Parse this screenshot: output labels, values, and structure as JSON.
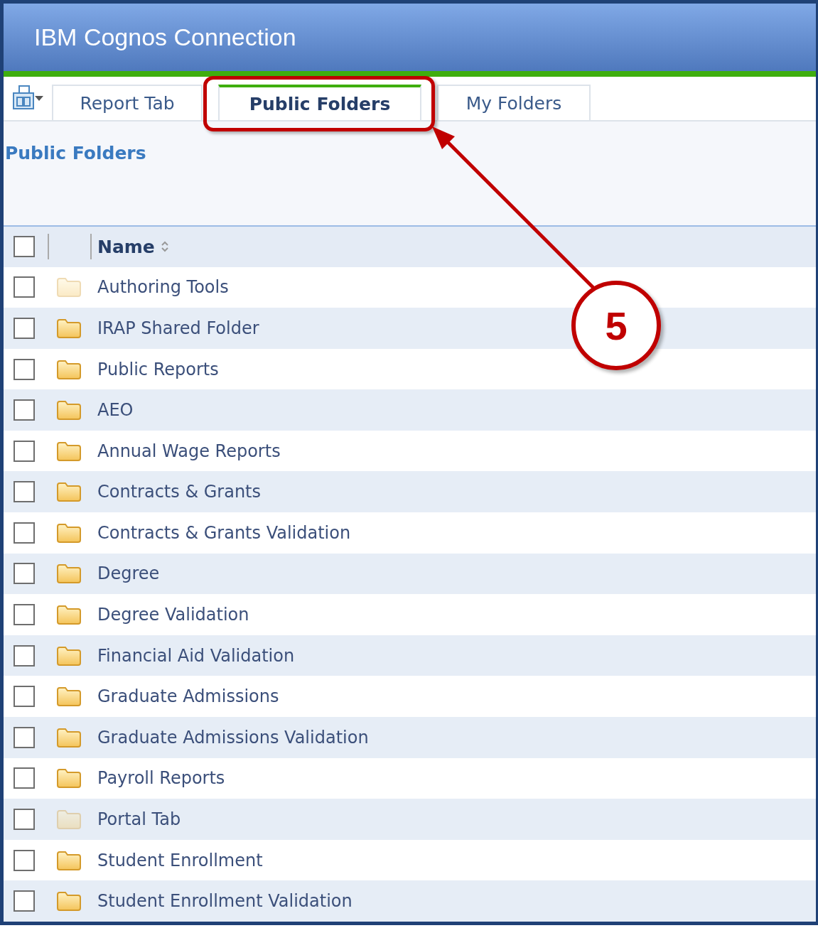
{
  "window": {
    "title": "IBM Cognos Connection"
  },
  "tabs": [
    {
      "label": "Report Tab",
      "selected": false
    },
    {
      "label": "Public Folders",
      "selected": true
    },
    {
      "label": "My Folders",
      "selected": false
    }
  ],
  "page_title": "Public Folders",
  "table": {
    "columns": [
      "Name"
    ],
    "header_checked": false,
    "rows": [
      {
        "name": "Authoring Tools",
        "checked": false,
        "hidden": true
      },
      {
        "name": "IRAP Shared Folder",
        "checked": false,
        "hidden": false
      },
      {
        "name": "Public Reports",
        "checked": false,
        "hidden": false
      },
      {
        "name": "AEO",
        "checked": false,
        "hidden": false
      },
      {
        "name": "Annual Wage Reports",
        "checked": false,
        "hidden": false
      },
      {
        "name": "Contracts & Grants",
        "checked": false,
        "hidden": false
      },
      {
        "name": "Contracts & Grants Validation",
        "checked": false,
        "hidden": false
      },
      {
        "name": "Degree",
        "checked": false,
        "hidden": false
      },
      {
        "name": "Degree Validation",
        "checked": false,
        "hidden": false
      },
      {
        "name": "Financial Aid Validation",
        "checked": false,
        "hidden": false
      },
      {
        "name": "Graduate Admissions",
        "checked": false,
        "hidden": false
      },
      {
        "name": "Graduate Admissions Validation",
        "checked": false,
        "hidden": false
      },
      {
        "name": "Payroll Reports",
        "checked": false,
        "hidden": false
      },
      {
        "name": "Portal Tab",
        "checked": false,
        "hidden": true
      },
      {
        "name": "Student Enrollment",
        "checked": false,
        "hidden": false
      },
      {
        "name": "Student Enrollment Validation",
        "checked": false,
        "hidden": false
      }
    ]
  },
  "annotation": {
    "label": "5"
  }
}
